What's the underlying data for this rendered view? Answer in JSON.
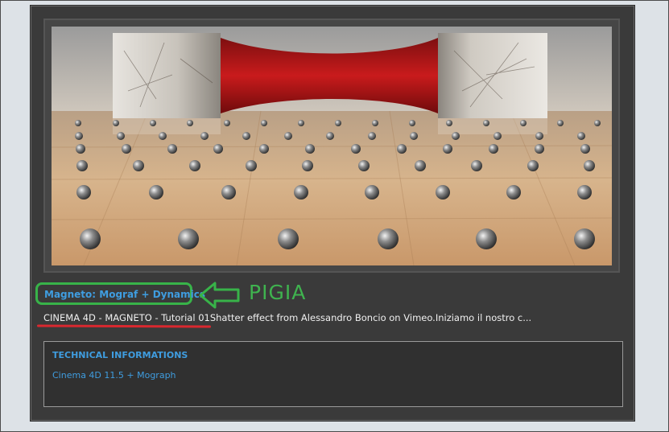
{
  "video": {
    "title": "Magneto: Mograf + Dynamics",
    "description": "CINEMA 4D - MAGNETO - Tutorial 01Shatter effect from Alessandro Boncio on Vimeo.Iniziamo il nostro c..."
  },
  "annotation": {
    "label": "PIGIA",
    "box_color": "#38b349",
    "underline_color": "#d9282f"
  },
  "tech_info": {
    "heading": "TECHNICAL INFORMATIONS",
    "text": "Cinema 4D 11.5 + Mograph"
  },
  "colors": {
    "link": "#3f9de0",
    "panel": "#3a3a3a",
    "page_bg": "#dde2e7"
  },
  "icons": {
    "thumbnail": "magnet-render-thumbnail",
    "pointer": "arrow-left-icon"
  }
}
